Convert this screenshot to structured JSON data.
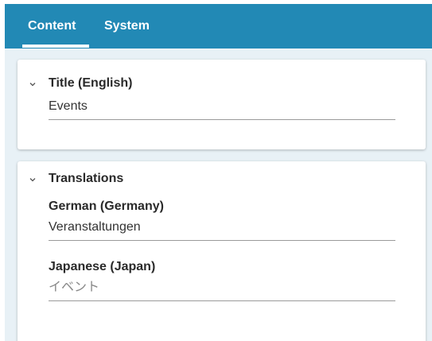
{
  "tabs": [
    {
      "label": "Content",
      "active": true
    },
    {
      "label": "System",
      "active": false
    }
  ],
  "title_section": {
    "heading": "Title (English)",
    "value": "Events"
  },
  "translations_section": {
    "heading": "Translations",
    "fields": [
      {
        "label": "German (Germany)",
        "value": "Veranstaltungen",
        "placeholder": ""
      },
      {
        "label": "Japanese (Japan)",
        "value": "",
        "placeholder": "イベント"
      }
    ]
  },
  "colors": {
    "tabbar": "#2289b5",
    "background": "#e8f1f6",
    "card": "#ffffff"
  },
  "icons": {
    "collapse": "chevron-down-icon"
  }
}
